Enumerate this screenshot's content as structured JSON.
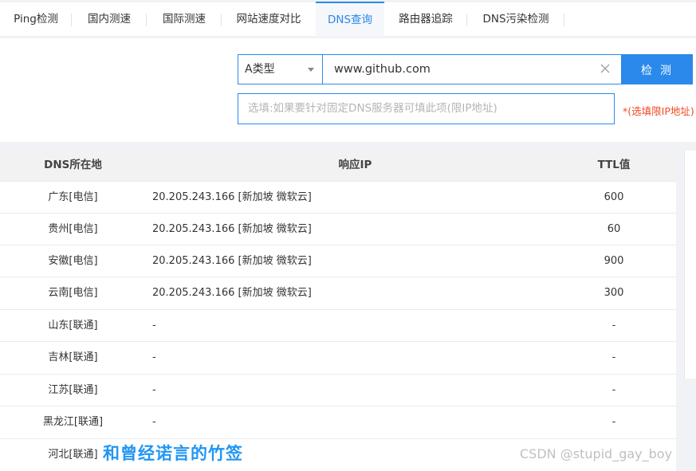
{
  "tabs": [
    {
      "label": "Ping检测"
    },
    {
      "label": "国内测速"
    },
    {
      "label": "国际测速"
    },
    {
      "label": "网站速度对比"
    },
    {
      "label": "DNS查询"
    },
    {
      "label": "路由器追踪"
    },
    {
      "label": "DNS污染检测"
    }
  ],
  "active_tab": "DNS查询",
  "search": {
    "record_type": "A类型",
    "domain_value": "www.github.com",
    "dns_placeholder": "选填:如果要针对固定DNS服务器可填此项(限IP地址)",
    "check_label": "检测",
    "hint": "*(选填限IP地址)"
  },
  "table": {
    "headers": {
      "location": "DNS所在地",
      "ip": "响应IP",
      "ttl": "TTL值"
    },
    "rows": [
      {
        "location": "广东[电信]",
        "ip": "20.205.243.166 [新加坡 微软云]",
        "ttl": "600"
      },
      {
        "location": "贵州[电信]",
        "ip": "20.205.243.166 [新加坡 微软云]",
        "ttl": "60"
      },
      {
        "location": "安徽[电信]",
        "ip": "20.205.243.166 [新加坡 微软云]",
        "ttl": "900"
      },
      {
        "location": "云南[电信]",
        "ip": "20.205.243.166 [新加坡 微软云]",
        "ttl": "300"
      },
      {
        "location": "山东[联通]",
        "ip": "-",
        "ttl": "-"
      },
      {
        "location": "吉林[联通]",
        "ip": "-",
        "ttl": "-"
      },
      {
        "location": "江苏[联通]",
        "ip": "-",
        "ttl": "-"
      },
      {
        "location": "黑龙江[联通]",
        "ip": "-",
        "ttl": "-"
      },
      {
        "location": "河北[联通]",
        "ip": "",
        "ttl": ""
      }
    ]
  },
  "overlay": {
    "caption": "和曾经诺言的竹签",
    "csdn": "CSDN @stupid_gay_boy"
  },
  "colors": {
    "accent": "#2a89ea",
    "hint": "#f04a22",
    "caption": "#2196f3"
  }
}
